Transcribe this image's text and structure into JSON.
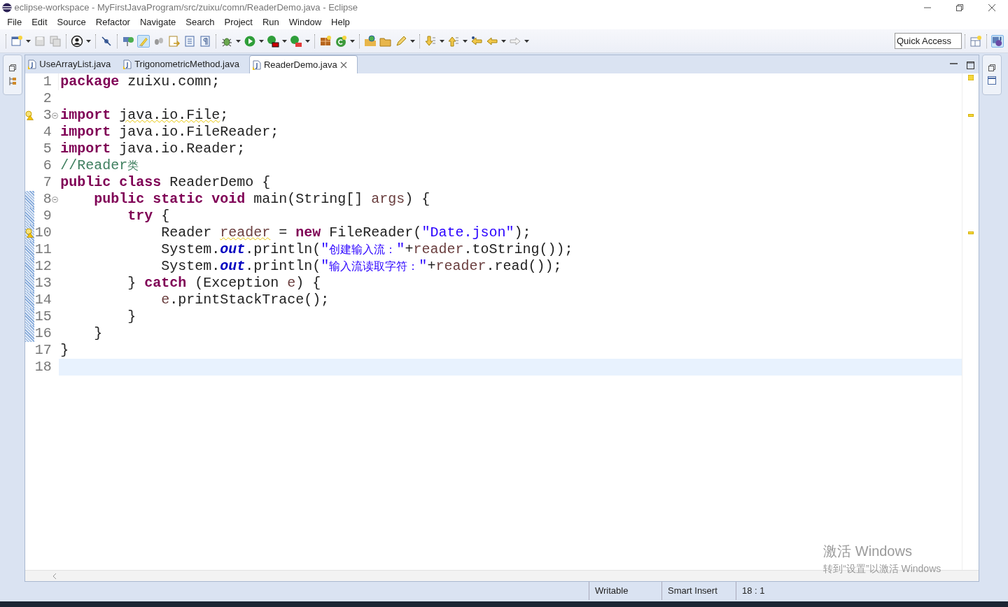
{
  "window": {
    "title": "eclipse-workspace - MyFirstJavaProgram/src/zuixu/comn/ReaderDemo.java - Eclipse"
  },
  "menu": [
    "File",
    "Edit",
    "Source",
    "Refactor",
    "Navigate",
    "Search",
    "Project",
    "Run",
    "Window",
    "Help"
  ],
  "toolbar": {
    "highlight_toggle_on": true
  },
  "quick_access": {
    "placeholder": "Quick Access"
  },
  "tabs": [
    {
      "label": "UseArrayList.java",
      "selected": false
    },
    {
      "label": "TrigonometricMethod.java",
      "selected": false
    },
    {
      "label": "ReaderDemo.java",
      "selected": true
    }
  ],
  "editor": {
    "lines": [
      {
        "number": "1",
        "tokens": [
          {
            "kind": "keyword",
            "text": "package"
          },
          {
            "kind": "text",
            "text": " zuixu.comn;"
          }
        ]
      },
      {
        "number": "2"
      },
      {
        "number": "3",
        "warning": true,
        "foldable": true,
        "tokens": [
          {
            "kind": "keyword",
            "text": "import "
          },
          {
            "kind": "text_warn",
            "text": "java.io.File"
          },
          {
            "kind": "text",
            "text": ";"
          }
        ]
      },
      {
        "number": "4",
        "tokens": [
          {
            "kind": "keyword",
            "text": "import"
          },
          {
            "kind": "text",
            "text": " java.io.FileReader;"
          }
        ]
      },
      {
        "number": "5",
        "tokens": [
          {
            "kind": "keyword",
            "text": "import"
          },
          {
            "kind": "text",
            "text": " java.io.Reader;"
          }
        ]
      },
      {
        "number": "6",
        "tokens": [
          {
            "kind": "comment",
            "text": "//Reader类"
          }
        ]
      },
      {
        "number": "7",
        "tokens": [
          {
            "kind": "keyword",
            "text": "public class"
          },
          {
            "kind": "text",
            "text": " ReaderDemo {"
          }
        ]
      },
      {
        "number": "8",
        "foldable": true,
        "in_range": true,
        "tokens": [
          {
            "kind": "keyword",
            "text": "    public static void"
          },
          {
            "kind": "text",
            "text": " main(String[] "
          },
          {
            "kind": "variable",
            "text": "args"
          },
          {
            "kind": "text",
            "text": ") {"
          }
        ]
      },
      {
        "number": "9",
        "in_range": true,
        "tokens": [
          {
            "kind": "keyword",
            "text": "        try"
          },
          {
            "kind": "text",
            "text": " {"
          }
        ]
      },
      {
        "number": "10",
        "warning": true,
        "in_range": true,
        "tokens": [
          {
            "kind": "text",
            "text": "            Reader "
          },
          {
            "kind": "variable_warn",
            "text": "reader"
          },
          {
            "kind": "text",
            "text": " = "
          },
          {
            "kind": "keyword",
            "text": "new"
          },
          {
            "kind": "text",
            "text": " FileReader("
          },
          {
            "kind": "string",
            "text": "\"Date.json\""
          },
          {
            "kind": "text",
            "text": ");"
          }
        ]
      },
      {
        "number": "11",
        "in_range": true,
        "tokens": [
          {
            "kind": "text",
            "text": "            System."
          },
          {
            "kind": "field",
            "text": "out"
          },
          {
            "kind": "text",
            "text": ".println("
          },
          {
            "kind": "string",
            "text": "\"创建输入流：\""
          },
          {
            "kind": "text",
            "text": "+"
          },
          {
            "kind": "variable",
            "text": "reader"
          },
          {
            "kind": "text",
            "text": ".toString());"
          }
        ]
      },
      {
        "number": "12",
        "in_range": true,
        "tokens": [
          {
            "kind": "text",
            "text": "            System."
          },
          {
            "kind": "field",
            "text": "out"
          },
          {
            "kind": "text",
            "text": ".println("
          },
          {
            "kind": "string",
            "text": "\"输入流读取字符：\""
          },
          {
            "kind": "text",
            "text": "+"
          },
          {
            "kind": "variable",
            "text": "reader"
          },
          {
            "kind": "text",
            "text": ".read());"
          }
        ]
      },
      {
        "number": "13",
        "in_range": true,
        "tokens": [
          {
            "kind": "text",
            "text": "        } "
          },
          {
            "kind": "keyword",
            "text": "catch"
          },
          {
            "kind": "text",
            "text": " (Exception "
          },
          {
            "kind": "variable",
            "text": "e"
          },
          {
            "kind": "text",
            "text": ") {"
          }
        ]
      },
      {
        "number": "14",
        "in_range": true,
        "tokens": [
          {
            "kind": "variable",
            "text": "            e"
          },
          {
            "kind": "text",
            "text": ".printStackTrace();"
          }
        ]
      },
      {
        "number": "15",
        "in_range": true,
        "tokens": [
          {
            "kind": "text",
            "text": "        }"
          }
        ]
      },
      {
        "number": "16",
        "in_range": true,
        "tokens": [
          {
            "kind": "text",
            "text": "    }"
          }
        ]
      },
      {
        "number": "17",
        "tokens": [
          {
            "kind": "text",
            "text": "}"
          }
        ]
      },
      {
        "number": "18",
        "current": true
      }
    ]
  },
  "activation_notice": {
    "title": "激活 Windows",
    "message": "转到“设置”以激活 Windows"
  },
  "status_bar": [
    "Writable",
    "Smart Insert",
    "18 : 1"
  ]
}
